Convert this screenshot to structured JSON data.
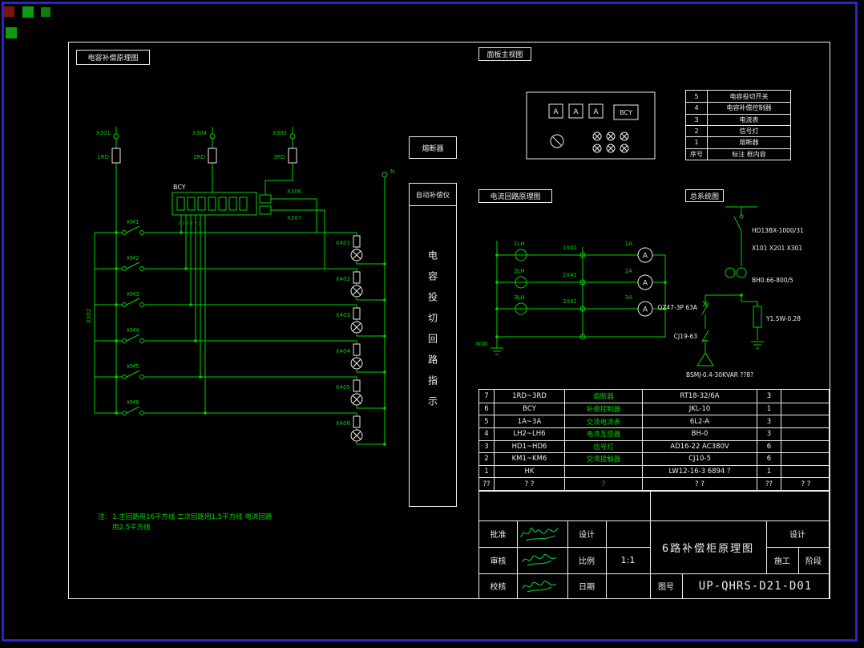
{
  "colors": {
    "line_green": "#00d400",
    "text_white": "#ededed",
    "frame_blue": "#2626cc",
    "icon_red": "#7c1212",
    "icon_green": "#0f9b0f"
  },
  "viewer_icons": [
    {
      "name": "red-marker-icon"
    },
    {
      "name": "green-marker-icon"
    },
    {
      "name": "green-marker-icon-2"
    },
    {
      "name": "green-marker-icon-3"
    }
  ],
  "section_labels": {
    "capacitor_schematic": "电容补偿原理图",
    "panel_view": "面板主视图",
    "current_loop": "电流回路原理图",
    "system_diagram": "总系统图"
  },
  "indicator_panel": {
    "fuse": "熔断器",
    "compensator": "自动补偿仪",
    "vertical_text": "电容投切回路指示"
  },
  "capacitor_schematic": {
    "feed_terminals": [
      "X301",
      "X304",
      "X305"
    ],
    "feed_fuses": [
      "1RD",
      "2RD",
      "3RD"
    ],
    "left_bus": "X302",
    "controller": "BCY",
    "controller_pins": "? ? ? ? ? ?",
    "aux_terminals": [
      "X306",
      "X307"
    ],
    "contactors": [
      "KM1",
      "KM2",
      "KM3",
      "KM4",
      "KM5",
      "KM6"
    ],
    "lamp_fuses": [
      "X401",
      "X402",
      "X403",
      "X404",
      "X405",
      "X406"
    ],
    "neutral": "N",
    "note_prefix": "注:",
    "note_line1": "1.主回路用16平方线 二次回路用1.5平方线 电流回路",
    "note_line2": "用2.5平方线"
  },
  "panel_view": {
    "meter_label": "A",
    "controller": "BCY"
  },
  "legend_table": {
    "rows": [
      [
        "5",
        "电容投切开关"
      ],
      [
        "4",
        "电容补偿控制器"
      ],
      [
        "3",
        "电流表"
      ],
      [
        "2",
        "信号灯"
      ],
      [
        "1",
        "熔断器"
      ],
      [
        "序号",
        "标注 框内容"
      ]
    ]
  },
  "current_loop": {
    "cts": [
      "1LH",
      "2LH",
      "3LH"
    ],
    "terminals": [
      "1X41",
      "2X41",
      "3X41"
    ],
    "meters": [
      "1A",
      "2A",
      "3A"
    ],
    "meter_glyph": "A",
    "neutral": "N00"
  },
  "system_diagram": {
    "isolator": "HD13BX-1000/31",
    "terminals": "X101 X201 X301",
    "ct": "BH0.66-800/5",
    "breaker": "QZ47-3P 63A",
    "contactor": "CJ19-63",
    "discharge": "Y1.5W-0.28",
    "capacitor_bank": "BSMJ-0.4-30KVAR ??8?"
  },
  "parts_table": {
    "rows": [
      [
        "7",
        "1RD~3RD",
        "熔断器",
        "RT18-32/6A",
        "3",
        ""
      ],
      [
        "6",
        "BCY",
        "补偿控制器",
        "JKL-10",
        "1",
        ""
      ],
      [
        "5",
        "1A~3A",
        "交流电流表",
        "6L2-A",
        "3",
        ""
      ],
      [
        "4",
        "LH2~LH6",
        "电流互感器",
        "BH-0",
        "3",
        ""
      ],
      [
        "3",
        "HD1~HD6",
        "信号灯",
        "AD16-22 AC380V",
        "6",
        ""
      ],
      [
        "2",
        "KM1~KM6",
        "交流接触器",
        "CJ10-5",
        "6",
        ""
      ],
      [
        "1",
        "HK",
        "",
        "LW12-16-3 6894 ?",
        "1",
        ""
      ],
      [
        "??",
        "? ?",
        "?",
        "? ?",
        "??",
        "? ?"
      ]
    ]
  },
  "title_block": {
    "approve": "批准",
    "review": "审核",
    "check": "校核",
    "design_label": "设计",
    "scale_label": "比例",
    "scale_value": "1:1",
    "date_label": "日期",
    "drawing_title": "6路补偿柜原理图",
    "stage_design": "设计",
    "stage_construction": "施工",
    "stage_label": "阶段",
    "dwg_no_label": "图号",
    "dwg_no": "UP-QHRS-D21-D01"
  }
}
